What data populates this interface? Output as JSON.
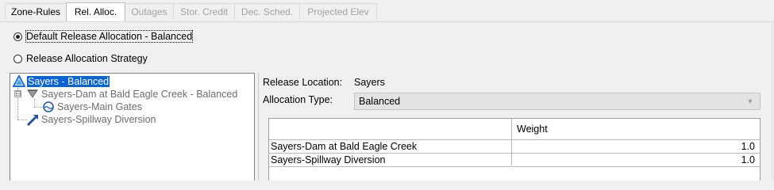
{
  "tabs": [
    {
      "label": "Zone-Rules",
      "state": "normal"
    },
    {
      "label": "Rel. Alloc.",
      "state": "active"
    },
    {
      "label": "Outages",
      "state": "disabled"
    },
    {
      "label": "Stor. Credit",
      "state": "disabled"
    },
    {
      "label": "Dec. Sched.",
      "state": "disabled"
    },
    {
      "label": "Projected Elev",
      "state": "disabled"
    }
  ],
  "radios": {
    "default_label": "Default Release Allocation - Balanced",
    "default_checked": true,
    "strategy_label": "Release Allocation Strategy",
    "strategy_checked": false
  },
  "tree": {
    "items": [
      {
        "label": "Sayers - Balanced",
        "icon": "reservoir-icon",
        "selected": true
      },
      {
        "label": "Sayers-Dam at Bald Eagle Creek - Balanced",
        "icon": "dam-icon",
        "expander": "⊟"
      },
      {
        "label": "Sayers-Main Gates",
        "icon": "gate-icon"
      },
      {
        "label": "Sayers-Spillway Diversion",
        "icon": "diversion-icon"
      }
    ]
  },
  "details": {
    "release_location_label": "Release Location:",
    "release_location_value": "Sayers",
    "allocation_type_label": "Allocation Type:",
    "allocation_type_value": "Balanced"
  },
  "grid": {
    "columns": [
      "",
      "Weight"
    ],
    "rows": [
      {
        "name": "Sayers-Dam at Bald Eagle Creek",
        "weight": "1.0"
      },
      {
        "name": "Sayers-Spillway Diversion",
        "weight": "1.0"
      }
    ]
  },
  "colors": {
    "selection": "#0a64d8",
    "reservoir_icon": "#1e6fd9",
    "disabled_text": "#a3a3a3"
  }
}
